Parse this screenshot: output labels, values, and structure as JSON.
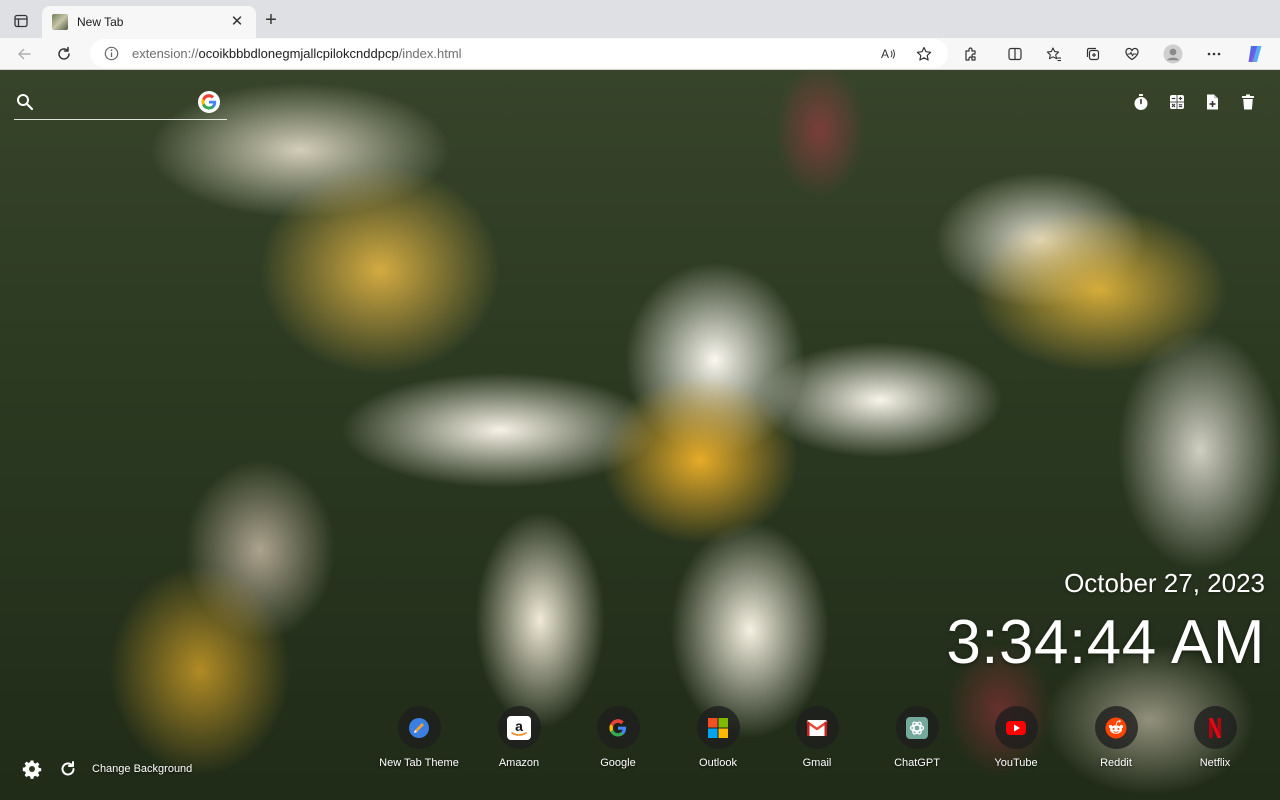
{
  "browser": {
    "tab": {
      "title": "New Tab"
    },
    "address": {
      "scheme": "extension://",
      "host": "ocoikbbbdlonegmjallcpilokcnddpcp",
      "path": "/index.html"
    }
  },
  "search": {
    "placeholder": "",
    "engine_icon": "google-icon"
  },
  "clock": {
    "date": "October 27, 2023",
    "time": "3:34:44 AM"
  },
  "shortcuts": [
    {
      "label": "New Tab Theme",
      "icon": "new-tab-theme-icon"
    },
    {
      "label": "Amazon",
      "icon": "amazon-icon"
    },
    {
      "label": "Google",
      "icon": "google-icon"
    },
    {
      "label": "Outlook",
      "icon": "microsoft-icon"
    },
    {
      "label": "Gmail",
      "icon": "gmail-icon"
    },
    {
      "label": "ChatGPT",
      "icon": "chatgpt-icon"
    },
    {
      "label": "YouTube",
      "icon": "youtube-icon"
    },
    {
      "label": "Reddit",
      "icon": "reddit-icon"
    },
    {
      "label": "Netflix",
      "icon": "netflix-icon"
    }
  ],
  "footer": {
    "change_background": "Change Background"
  },
  "colors": {
    "accent": "#1a73e8",
    "text_on_image": "#ffffff"
  }
}
